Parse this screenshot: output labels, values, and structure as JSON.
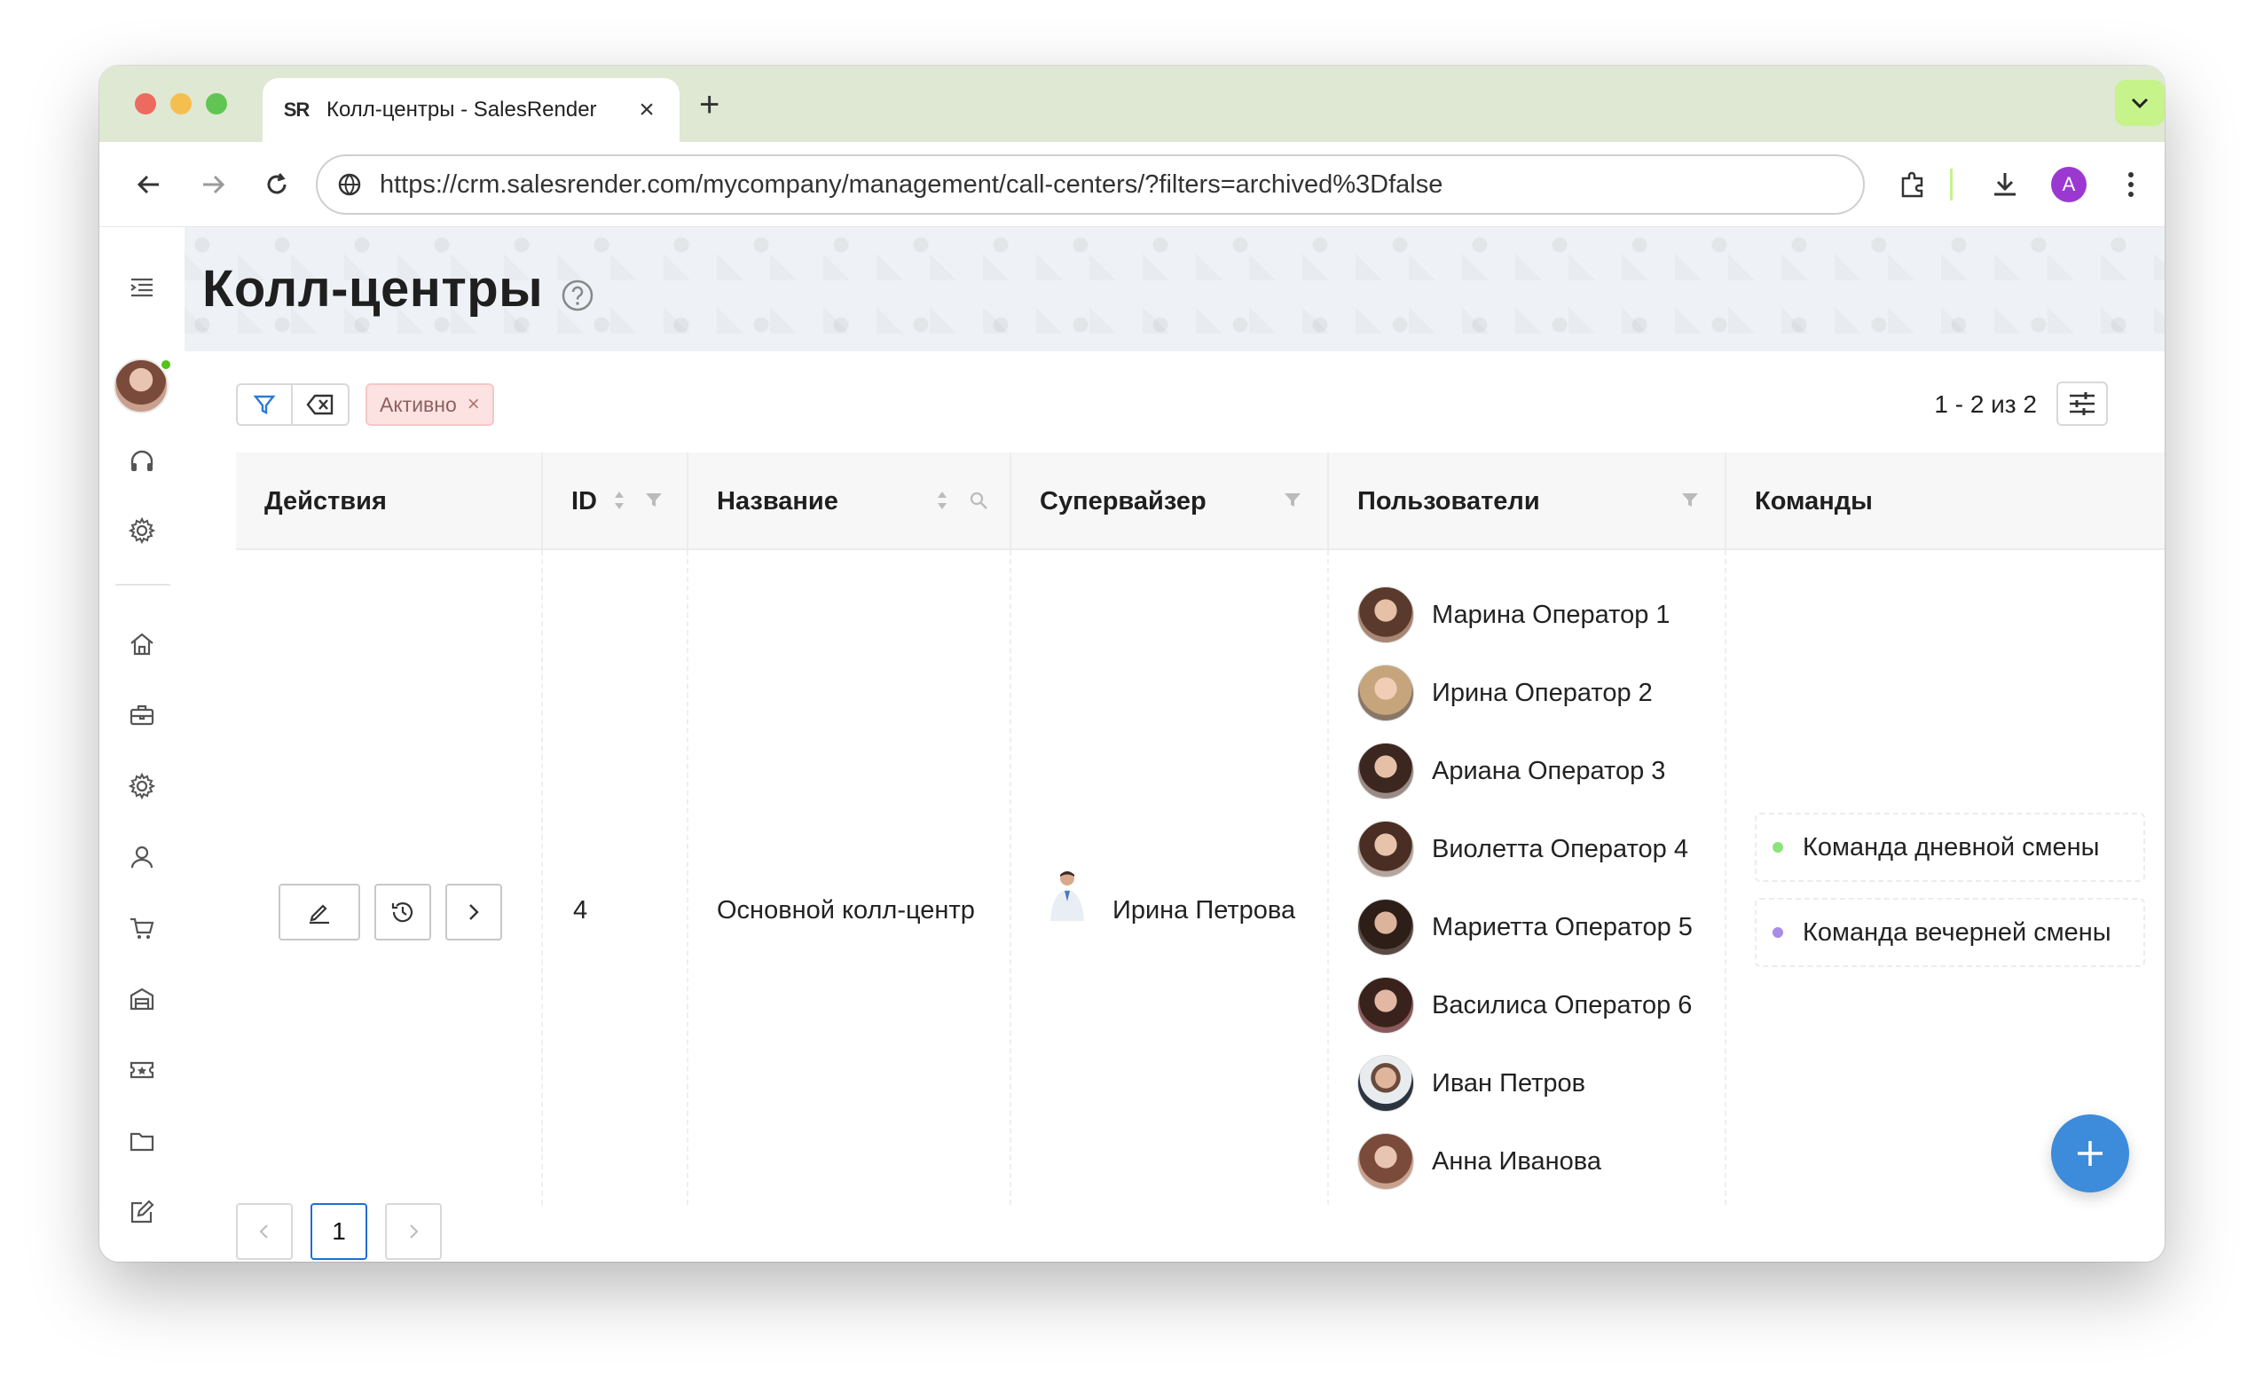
{
  "browser": {
    "tab_title": "Колл-центры - SalesRender",
    "tab_favicon_text": "SR",
    "url": "https://crm.salesrender.com/mycompany/management/call-centers/?filters=archived%3Dfalse",
    "profile_initial": "A"
  },
  "page": {
    "title": "Колл-центры"
  },
  "filters": {
    "active_chip": "Активно",
    "range_text": "1 - 2 из 2"
  },
  "table": {
    "headers": {
      "actions": "Действия",
      "id": "ID",
      "name": "Название",
      "supervisor": "Супервайзер",
      "users": "Пользователи",
      "teams": "Команды"
    },
    "row": {
      "id": "4",
      "name": "Основной колл-центр",
      "supervisor": "Ирина Петрова",
      "users": [
        "Марина Оператор 1",
        "Ирина Оператор 2",
        "Ариана Оператор 3",
        "Виолетта Оператор 4",
        "Мариетта Оператор 5",
        "Василиса Оператор 6",
        "Иван Петров",
        "Анна Иванова"
      ],
      "teams": [
        {
          "name": "Команда дневной смены",
          "color": "#8ee27a"
        },
        {
          "name": "Команда вечерней смены",
          "color": "#a98be8"
        }
      ]
    }
  },
  "pagination": {
    "current_page": "1"
  },
  "colors": {
    "accent": "#3d8bdb",
    "chip_bg": "#fde2e2",
    "tab_strip": "#dfe8d3"
  }
}
